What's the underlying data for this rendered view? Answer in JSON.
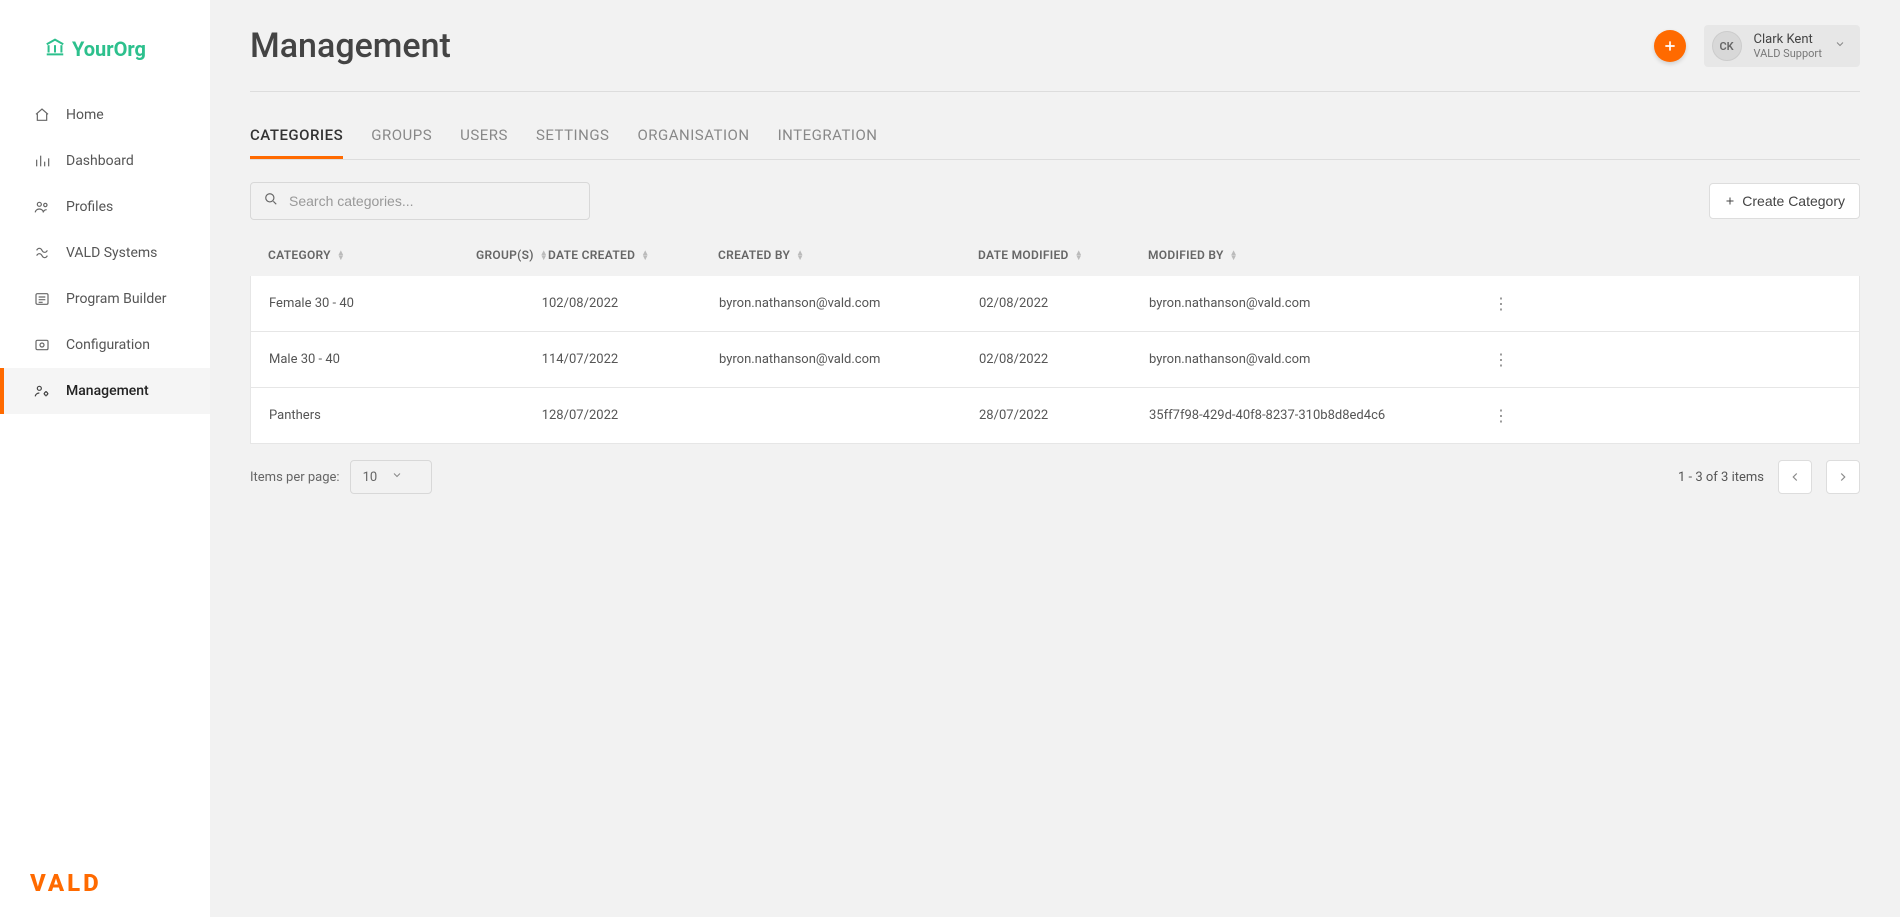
{
  "brand": {
    "org_text": "YourOrg",
    "footer_brand": "VALD"
  },
  "sidebar": {
    "items": [
      {
        "label": "Home"
      },
      {
        "label": "Dashboard"
      },
      {
        "label": "Profiles"
      },
      {
        "label": "VALD Systems"
      },
      {
        "label": "Program Builder"
      },
      {
        "label": "Configuration"
      },
      {
        "label": "Management"
      }
    ]
  },
  "header": {
    "title": "Management",
    "user": {
      "initials": "CK",
      "name": "Clark Kent",
      "org": "VALD Support"
    }
  },
  "tabs": [
    {
      "label": "CATEGORIES",
      "active": true
    },
    {
      "label": "GROUPS"
    },
    {
      "label": "USERS"
    },
    {
      "label": "SETTINGS"
    },
    {
      "label": "ORGANISATION"
    },
    {
      "label": "INTEGRATION"
    }
  ],
  "toolbar": {
    "search_placeholder": "Search categories...",
    "create_label": "Create Category"
  },
  "table": {
    "columns": [
      "CATEGORY",
      "GROUP(S)",
      "DATE CREATED",
      "CREATED BY",
      "DATE MODIFIED",
      "MODIFIED BY"
    ],
    "rows": [
      {
        "category": "Female 30 - 40",
        "groups": "1",
        "created": "02/08/2022",
        "created_by": "byron.nathanson@vald.com",
        "modified": "02/08/2022",
        "modified_by": "byron.nathanson@vald.com"
      },
      {
        "category": "Male 30 - 40",
        "groups": "1",
        "created": "14/07/2022",
        "created_by": "byron.nathanson@vald.com",
        "modified": "02/08/2022",
        "modified_by": "byron.nathanson@vald.com"
      },
      {
        "category": "Panthers",
        "groups": "1",
        "created": "28/07/2022",
        "created_by": "",
        "modified": "28/07/2022",
        "modified_by": "35ff7f98-429d-40f8-8237-310b8d8ed4c6"
      }
    ]
  },
  "pagination": {
    "items_per_page_label": "Items per page:",
    "items_per_page_value": "10",
    "range_text": "1 - 3 of 3 items"
  }
}
